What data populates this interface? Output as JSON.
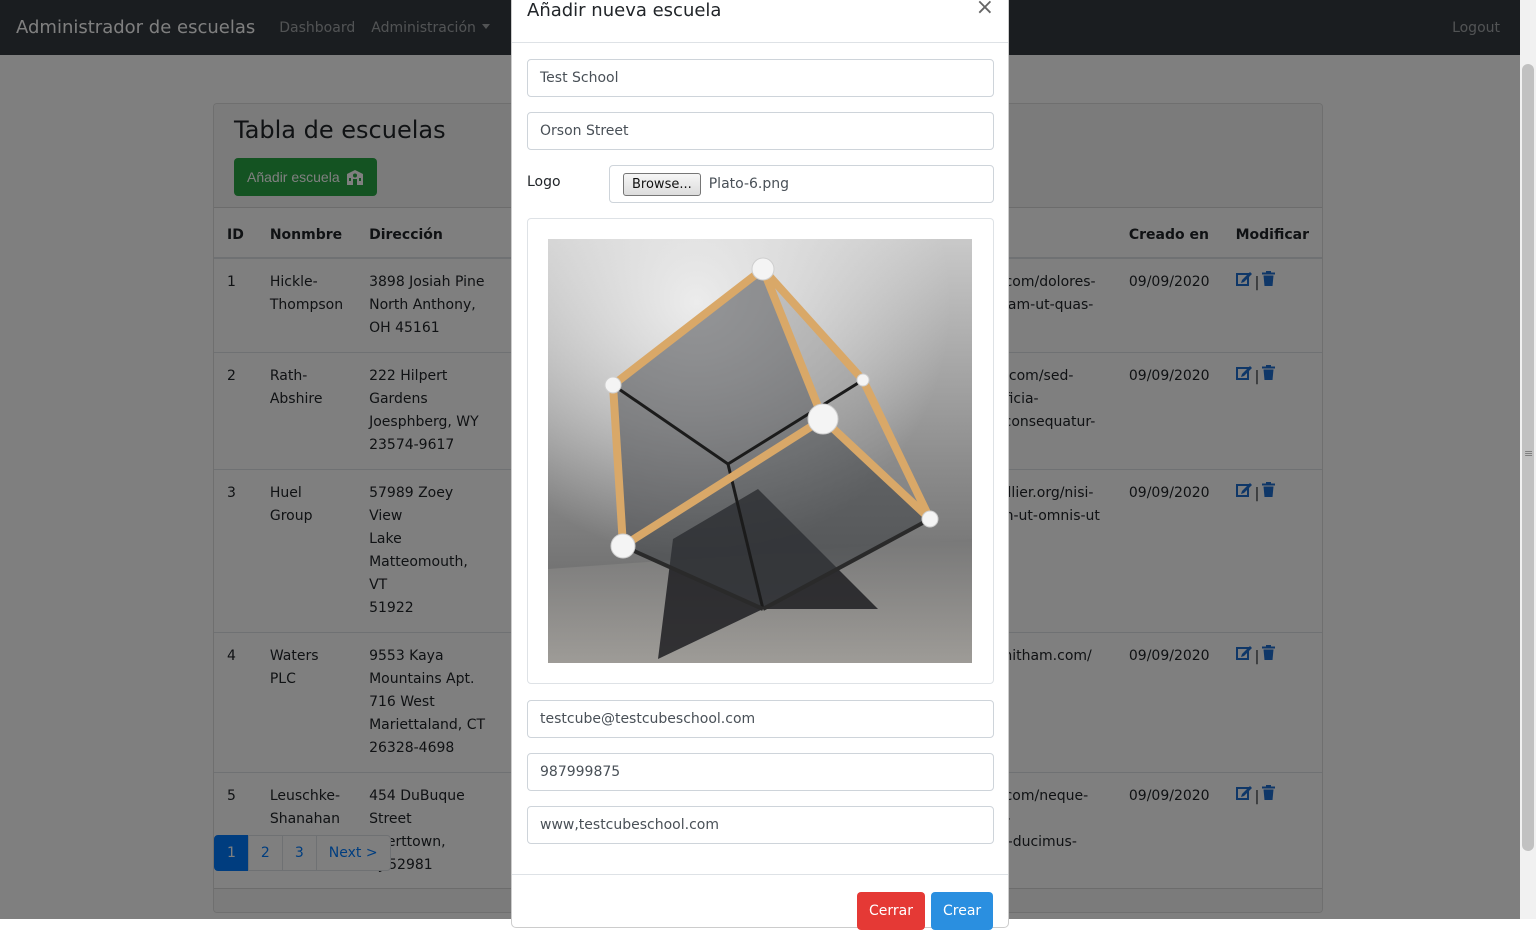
{
  "navbar": {
    "brand": "Administrador de escuelas",
    "links": [
      "Dashboard",
      "Administración"
    ],
    "logout": "Logout"
  },
  "page": {
    "title": "Tabla de escuelas",
    "add_button": "Añadir escuela"
  },
  "table": {
    "headers": [
      "ID",
      "Nonmbre",
      "Dirección",
      "Creado en",
      "Modificar"
    ],
    "rows": [
      {
        "id": "1",
        "name": "Hickle-\nThompson",
        "address": "3898 Josiah Pine\nNorth Anthony,\nOH 45161",
        "url": "h.com/dolores-\nullam-ut-quas-",
        "created": "09/09/2020"
      },
      {
        "id": "2",
        "name": "Rath-\nAbshire",
        "address": "222 Hilpert\nGardens\nJoesphberg, WY\n23574-9617",
        "url": "ct.com/sed-officia-\ns-consequatur-\nm",
        "created": "09/09/2020"
      },
      {
        "id": "3",
        "name": "Huel\nGroup",
        "address": "57989 Zoey View\nLake\nMatteomouth, VT\n51922",
        "url": "collier.org/nisi-\nam-ut-omnis-ut",
        "created": "09/09/2020"
      },
      {
        "id": "4",
        "name": "Waters\nPLC",
        "address": "9553 Kaya\nMountains Apt.\n716 West\nMariettaland, CT\n26328-4698",
        "url": "smitham.com/",
        "created": "09/09/2020"
      },
      {
        "id": "5",
        "name": "Leuschke-\nShanahan",
        "address": "454 DuBuque\nStreet Eberttown,\nNJ 52981",
        "url": "h.com/neque-at-\nlla-ducimus-",
        "created": "09/09/2020"
      }
    ]
  },
  "pagination": {
    "pages": [
      "1",
      "2",
      "3"
    ],
    "next": "Next >",
    "active": "1"
  },
  "modal": {
    "title": "Añadir nueva escuela",
    "close": "×",
    "name_value": "Test School",
    "address_value": "Orson Street",
    "logo_label": "Logo",
    "browse_label": "Browse...",
    "file_name": "Plato-6.png",
    "email_value": "testcube@testcubeschool.com",
    "phone_value": "987999875",
    "website_value": "www,testcubeschool.com",
    "cancel_button": "Cerrar",
    "submit_button": "Crear"
  },
  "colors": {
    "navbar": "#343a40",
    "success": "#28a745",
    "primary": "#007bff",
    "danger": "#e53935",
    "submit": "#2a8fe0"
  },
  "icons": {
    "add_button_icon": "school-icon",
    "edit": "edit-icon",
    "delete": "trash-icon",
    "close": "close-icon"
  }
}
